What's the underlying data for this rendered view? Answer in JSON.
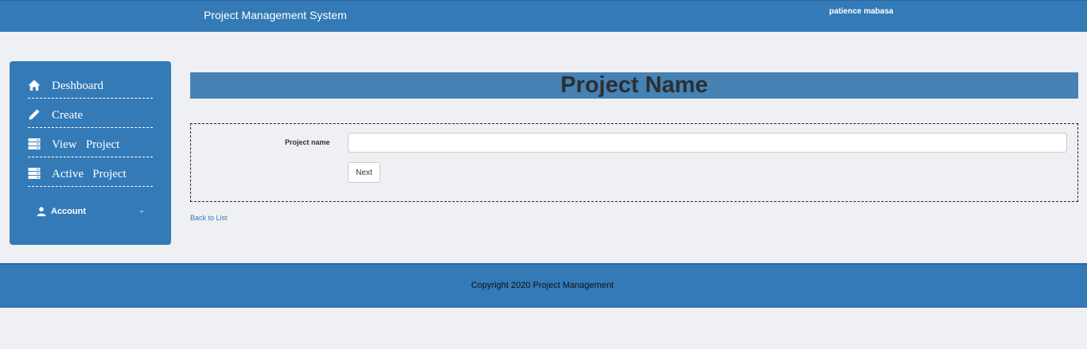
{
  "header": {
    "app_title": "Project Management System",
    "user_name": "patience mabasa"
  },
  "sidebar": {
    "items": [
      {
        "label": "Deshboard",
        "icon": "home-icon"
      },
      {
        "label": "Create",
        "icon": "pencil-icon"
      },
      {
        "label": "View   Project",
        "icon": "server-icon"
      },
      {
        "label": "Active   Project",
        "icon": "server-icon"
      }
    ],
    "account": {
      "label": "Account",
      "icon": "user-icon"
    }
  },
  "main": {
    "page_title": "Project Name",
    "form": {
      "project_name_label": "Project name",
      "project_name_value": "",
      "next_label": "Next"
    },
    "back_link": "Back to List"
  },
  "footer": {
    "copyright": "Copyright 2020 Project Management"
  },
  "colors": {
    "primary": "#337ab7",
    "title_bar": "#4682b4",
    "page_bg": "#eef0f4"
  }
}
